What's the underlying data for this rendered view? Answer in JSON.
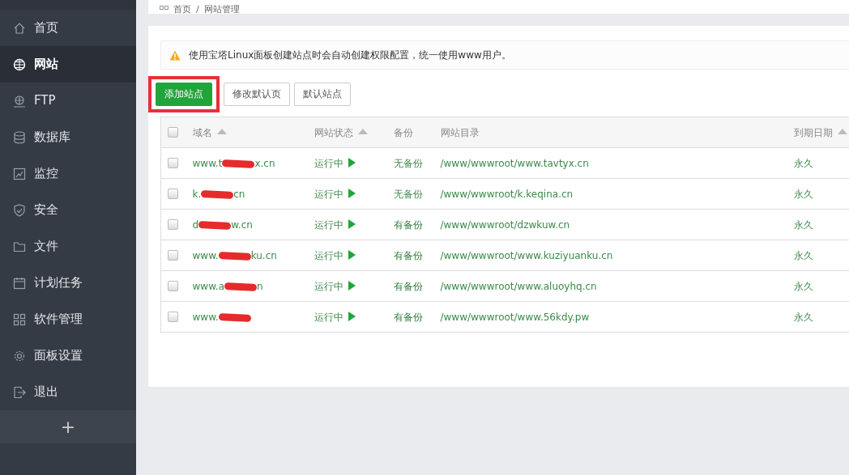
{
  "breadcrumb": {
    "home": "首页",
    "separator": "/",
    "current": "网站管理"
  },
  "sidebar": {
    "items": [
      {
        "label": "首页",
        "selected": false
      },
      {
        "label": "网站",
        "selected": true
      },
      {
        "label": "FTP",
        "selected": false
      },
      {
        "label": "数据库",
        "selected": false
      },
      {
        "label": "监控",
        "selected": false
      },
      {
        "label": "安全",
        "selected": false
      },
      {
        "label": "文件",
        "selected": false
      },
      {
        "label": "计划任务",
        "selected": false
      },
      {
        "label": "软件管理",
        "selected": false
      },
      {
        "label": "面板设置",
        "selected": false
      },
      {
        "label": "退出",
        "selected": false
      }
    ],
    "add_button": "+"
  },
  "notice": "使用宝塔Linux面板创建站点时会自动创建权限配置，统一使用www用户。",
  "toolbar": [
    {
      "label": "添加站点",
      "kind": "primary",
      "highlighted": true
    },
    {
      "label": "修改默认页",
      "kind": "default",
      "highlighted": false
    },
    {
      "label": "默认站点",
      "kind": "default",
      "highlighted": false
    }
  ],
  "table": {
    "select_all_checked": false,
    "columns": [
      {
        "label": "域名",
        "sortable": true
      },
      {
        "label": "网站状态",
        "sortable": true
      },
      {
        "label": "备份",
        "sortable": false
      },
      {
        "label": "网站目录",
        "sortable": false
      },
      {
        "label": "到期日期",
        "sortable": true
      }
    ],
    "rows": [
      {
        "checked": false,
        "domain_start": "www.t",
        "domain_end": "x.cn",
        "status": "运行中",
        "backup": "无备份",
        "has_backup": false,
        "directory": "/www/wwwroot/www.tavtyx.cn",
        "expiry": "永久"
      },
      {
        "checked": false,
        "domain_start": "k.",
        "domain_end": "cn",
        "status": "运行中",
        "backup": "无备份",
        "has_backup": false,
        "directory": "/www/wwwroot/k.keqina.cn",
        "expiry": "永久"
      },
      {
        "checked": false,
        "domain_start": "d",
        "domain_end": "w.cn",
        "status": "运行中",
        "backup": "有备份",
        "has_backup": true,
        "directory": "/www/wwwroot/dzwkuw.cn",
        "expiry": "永久"
      },
      {
        "checked": false,
        "domain_start": "www.",
        "domain_end": "ku.cn",
        "status": "运行中",
        "backup": "有备份",
        "has_backup": true,
        "directory": "/www/wwwroot/www.kuziyuanku.cn",
        "expiry": "永久"
      },
      {
        "checked": false,
        "domain_start": "www.a",
        "domain_end": "n",
        "status": "运行中",
        "backup": "有备份",
        "has_backup": true,
        "directory": "/www/wwwroot/www.aluoyhq.cn",
        "expiry": "永久"
      },
      {
        "checked": false,
        "domain_start": "www.",
        "status": "运行中",
        "backup": "有备份",
        "has_backup": true,
        "directory": "/www/wwwroot/www.56kdy.pw",
        "expiry": "永久"
      }
    ]
  }
}
